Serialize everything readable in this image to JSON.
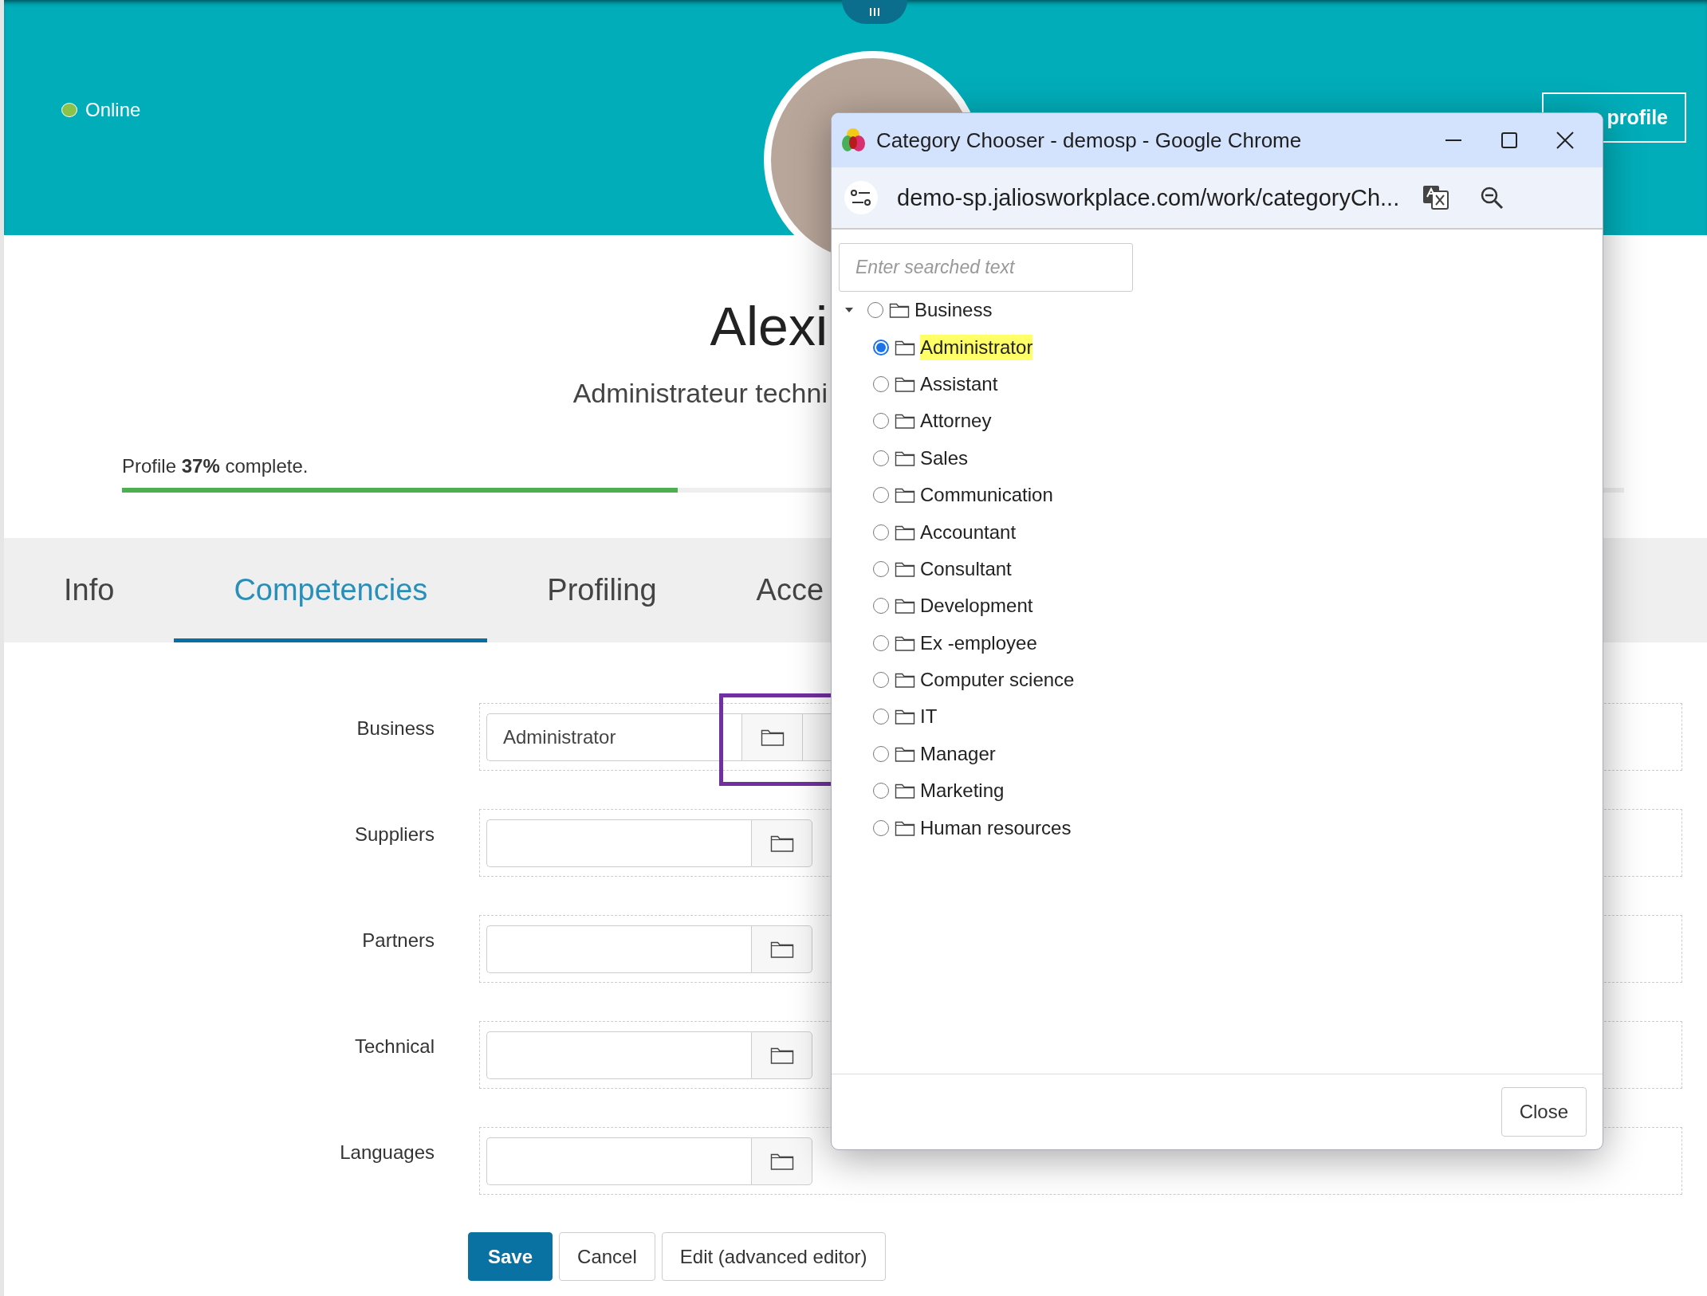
{
  "header": {
    "status": {
      "label": "Online",
      "color": "#8bc34a"
    },
    "profile_button": "profile"
  },
  "profile": {
    "name": "Alexi",
    "job_title": "Administrateur techni",
    "completion": {
      "text": "Profile **37%** complete.",
      "level": 0.37
    }
  },
  "tabs": [
    {
      "label": "Info",
      "selected": false
    },
    {
      "label": "Competencies",
      "selected": true
    },
    {
      "label": "Profiling",
      "selected": false
    },
    {
      "label": "Acce",
      "selected": false
    }
  ],
  "form": {
    "fields": [
      {
        "label": "Business",
        "value": "Administrator",
        "highlighted": true
      },
      {
        "label": "Suppliers",
        "highlighted": false
      },
      {
        "label": "Partners",
        "highlighted": false
      },
      {
        "label": "Technical",
        "highlighted": false
      },
      {
        "label": "Languages",
        "highlighted": false
      }
    ],
    "buttons": [
      {
        "label": "Save",
        "kind": "primary"
      },
      {
        "label": "Cancel",
        "kind": "default"
      },
      {
        "label": "Edit (advanced editor)",
        "kind": "default"
      }
    ]
  },
  "chooser": {
    "window_title": "Category Chooser - demosp - Google Chrome",
    "url": "demo-sp.jaliosworkplace.com/work/categoryCh...",
    "search": {
      "placeholder": "Enter searched text"
    },
    "tree": [
      {
        "label": "Business",
        "selected": false,
        "expanded": true,
        "children": [
          {
            "label": "Administrator",
            "selected": true
          },
          {
            "label": "Assistant",
            "selected": false
          },
          {
            "label": "Attorney",
            "selected": false
          },
          {
            "label": "Sales",
            "selected": false
          },
          {
            "label": "Communication",
            "selected": false
          },
          {
            "label": "Accountant",
            "selected": false
          },
          {
            "label": "Consultant",
            "selected": false
          },
          {
            "label": "Development",
            "selected": false
          },
          {
            "label": "Ex -employee",
            "selected": false
          },
          {
            "label": "Computer science",
            "selected": false
          },
          {
            "label": "IT",
            "selected": false
          },
          {
            "label": "Manager",
            "selected": false
          },
          {
            "label": "Marketing",
            "selected": false
          },
          {
            "label": "Human resources",
            "selected": false
          }
        ]
      }
    ],
    "close_button": "Close"
  }
}
